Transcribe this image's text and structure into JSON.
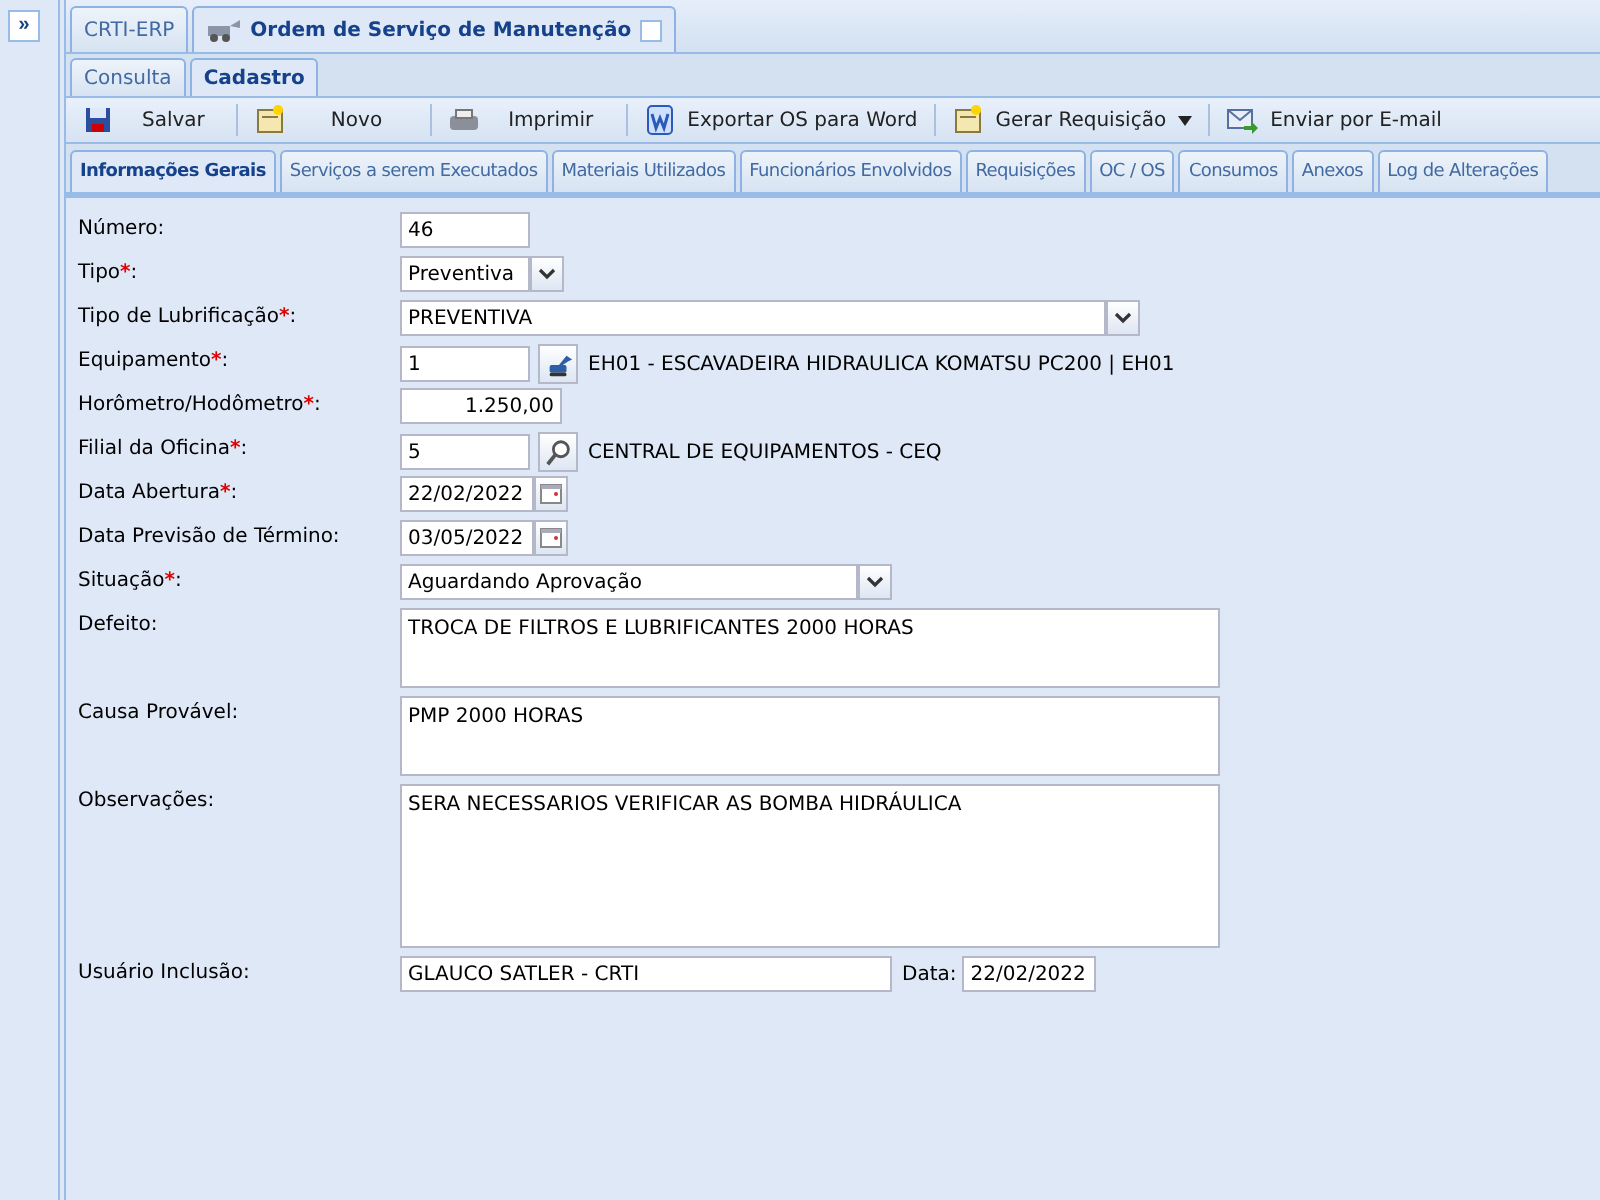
{
  "sidebar": {
    "expand_button": "»"
  },
  "window_tabs": [
    {
      "label": "CRTI-ERP",
      "selected": false,
      "closable": false
    },
    {
      "label": "Ordem de Serviço de Manutenção",
      "selected": true,
      "closable": true
    }
  ],
  "mode_tabs": [
    {
      "label": "Consulta",
      "selected": false
    },
    {
      "label": "Cadastro",
      "selected": true
    }
  ],
  "toolbar": [
    {
      "kind": "save",
      "label": "Salvar",
      "menu": false
    },
    {
      "kind": "new",
      "label": "Novo",
      "menu": false
    },
    {
      "kind": "print",
      "label": "Imprimir",
      "menu": false
    },
    {
      "kind": "word",
      "label": "Exportar OS para Word",
      "menu": false
    },
    {
      "kind": "new",
      "label": "Gerar Requisição",
      "menu": true
    },
    {
      "kind": "mail",
      "label": "Enviar por E-mail",
      "menu": false
    }
  ],
  "section_tabs": [
    {
      "label": "Informações Gerais",
      "selected": true
    },
    {
      "label": "Serviços a serem Executados",
      "selected": false
    },
    {
      "label": "Materiais Utilizados",
      "selected": false
    },
    {
      "label": "Funcionários Envolvidos",
      "selected": false
    },
    {
      "label": "Requisições",
      "selected": false
    },
    {
      "label": "OC / OS",
      "selected": false
    },
    {
      "label": "Consumos",
      "selected": false
    },
    {
      "label": "Anexos",
      "selected": false
    },
    {
      "label": "Log de Alterações",
      "selected": false
    }
  ],
  "fields": [
    {
      "label": "Número:",
      "kind": "text",
      "value": "46"
    },
    {
      "label": "Tipo",
      "required_mark": "*",
      "label_suffix": ":",
      "kind": "select",
      "value": "Preventiva"
    },
    {
      "label": "Tipo de Lubrificação",
      "required_mark": "*",
      "label_suffix": ":",
      "kind": "combo",
      "value": "PREVENTIVA"
    },
    {
      "label": "Equipamento",
      "required_mark": "*",
      "label_suffix": ":",
      "kind": "lookup-vehicle",
      "value": "1",
      "description": "EH01 - ESCAVADEIRA HIDRAULICA KOMATSU PC200 | EH01"
    },
    {
      "label": "Horômetro/Hodômetro",
      "required_mark": "*",
      "label_suffix": ":",
      "kind": "amount",
      "value": "1.250,00"
    },
    {
      "label": "Filial da Oficina",
      "required_mark": "*",
      "label_suffix": ":",
      "kind": "lookup-search",
      "value": "5",
      "description": "CENTRAL DE EQUIPAMENTOS - CEQ"
    },
    {
      "label": "Data Abertura",
      "required_mark": "*",
      "label_suffix": ":",
      "kind": "date",
      "value": "22/02/2022"
    },
    {
      "label": "Data Previsão de Término:",
      "kind": "date",
      "value": "03/05/2022"
    },
    {
      "label": "Situação",
      "required_mark": "*",
      "label_suffix": ":",
      "kind": "status",
      "value": "Aguardando Aprovação"
    },
    {
      "label": "Defeito:",
      "kind": "memo",
      "value": "TROCA DE FILTROS E LUBRIFICANTES 2000 HORAS"
    },
    {
      "label": "Causa Provável:",
      "kind": "memo",
      "value": "PMP 2000 HORAS"
    },
    {
      "label": "Observações:",
      "kind": "memo-large",
      "value": "SERA NECESSARIOS VERIFICAR AS BOMBA HIDRÁULICA"
    }
  ],
  "footer": {
    "user_label": "Usuário Inclusão:",
    "user_value": "GLAUCO SATLER - CRTI",
    "date_label": "Data:",
    "date_value": "22/02/2022"
  }
}
